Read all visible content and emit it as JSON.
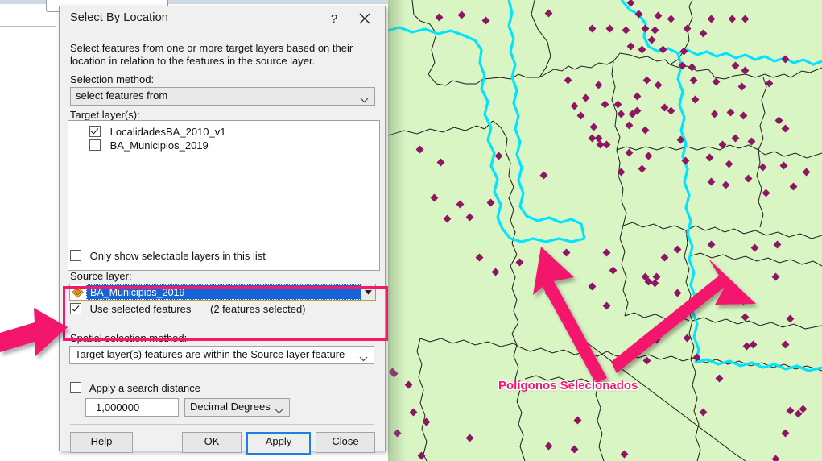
{
  "window": {
    "title": "Select By Location",
    "help_glyph": "?",
    "close_icon": "close-icon"
  },
  "dialog": {
    "description": "Select features from one or more target layers based on their location in relation to the features in the source layer.",
    "selection_method_label": "Selection method:",
    "selection_method_value": "select features from",
    "target_layers_label": "Target layer(s):",
    "target_layers": [
      {
        "label": "LocalidadesBA_2010_v1",
        "checked": true
      },
      {
        "label": "BA_Municipios_2019",
        "checked": false
      }
    ],
    "only_selectable_label": "Only show selectable layers in this list",
    "only_selectable_checked": false,
    "source_layer_label": "Source layer:",
    "source_layer_value": "BA_Municipios_2019",
    "source_layer_icon": "polygon-layer-icon",
    "use_selected_label": "Use selected features",
    "use_selected_checked": true,
    "features_selected_text": "(2 features selected)",
    "spatial_method_label": "Spatial selection method:",
    "spatial_method_value": "Target layer(s) features are within the Source layer feature",
    "search_distance_label": "Apply a search distance",
    "search_distance_checked": false,
    "search_distance_value": "1,000000",
    "distance_units_value": "Decimal Degrees",
    "buttons": {
      "help": "Help",
      "ok": "OK",
      "apply": "Apply",
      "close": "Close"
    }
  },
  "map": {
    "background_color": "#d9f5c4",
    "point_color": "#8e1464",
    "boundary_color": "#1a1a1a",
    "selected_boundary_color": "#00e4ff"
  },
  "annotations": {
    "callout_text": "Polígonos Selecionados",
    "callout_color": "#f4196c",
    "highlight_box_color": "#f4196c",
    "arrows": [
      {
        "name": "arrow-to-left-polygon"
      },
      {
        "name": "arrow-to-right-polygon"
      },
      {
        "name": "arrow-to-use-selected-features"
      }
    ]
  }
}
